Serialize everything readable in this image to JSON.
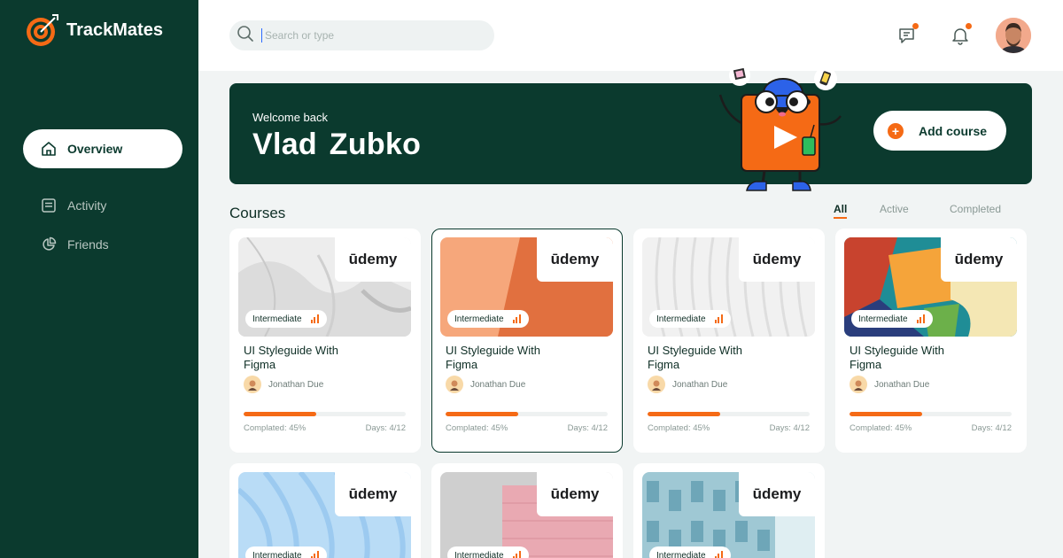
{
  "app": {
    "name": "TrackMates"
  },
  "sidebar": {
    "items": [
      {
        "label": "Overview",
        "icon": "home-icon",
        "active": true
      },
      {
        "label": "Activity",
        "icon": "activity-icon",
        "active": false
      },
      {
        "label": "Friends",
        "icon": "friends-icon",
        "active": false
      }
    ]
  },
  "search": {
    "placeholder": "Search or type",
    "value": ""
  },
  "header": {
    "icons": [
      "messages-icon",
      "bell-icon",
      "avatar"
    ]
  },
  "hero": {
    "welcome": "Welcome back",
    "name": "Vlad  Zubko",
    "add_button_label": "Add course"
  },
  "courses": {
    "title": "Courses",
    "filters": [
      {
        "label": "All",
        "active": true
      },
      {
        "label": "Active",
        "active": false
      },
      {
        "label": "Completed",
        "active": false
      }
    ],
    "cards": [
      {
        "brand": "ūdemy",
        "level": "Intermediate",
        "title": "UI Styleguide With Figma",
        "author": "Jonathan Due",
        "progress_label": "Complated: 45%",
        "progress": 0.45,
        "days": "Days: 4/12",
        "selected": false
      },
      {
        "brand": "ūdemy",
        "level": "Intermediate",
        "title": "UI Styleguide With Figma",
        "author": "Jonathan Due",
        "progress_label": "Complated: 45%",
        "progress": 0.45,
        "days": "Days: 4/12",
        "selected": true
      },
      {
        "brand": "ūdemy",
        "level": "Intermediate",
        "title": "UI Styleguide With Figma",
        "author": "Jonathan Due",
        "progress_label": "Complated: 45%",
        "progress": 0.45,
        "days": "Days: 4/12",
        "selected": false
      },
      {
        "brand": "ūdemy",
        "level": "Intermediate",
        "title": "UI Styleguide With Figma",
        "author": "Jonathan Due",
        "progress_label": "Complated: 45%",
        "progress": 0.45,
        "days": "Days: 4/12",
        "selected": false
      },
      {
        "brand": "ūdemy",
        "level": "Intermediate"
      },
      {
        "brand": "ūdemy",
        "level": "Intermediate"
      },
      {
        "brand": "ūdemy",
        "level": "Intermediate"
      }
    ]
  },
  "colors": {
    "sidebar": "#0b3a2e",
    "accent": "#f56a15",
    "background": "#f1f4f4"
  }
}
